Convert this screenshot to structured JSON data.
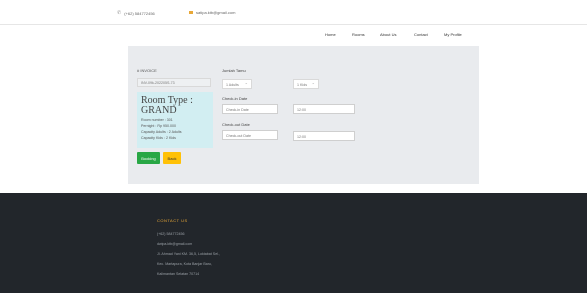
{
  "topbar": {
    "phone": "(+62) 584772456",
    "email": "satipa.ktb@gmail.com",
    "phone_icon": "phone-icon",
    "mail_icon": "mail-icon"
  },
  "nav": {
    "home": "Home",
    "rooms": "Rooms",
    "about": "About Us",
    "contact": "Contact",
    "profile": "My Profile"
  },
  "invoice": {
    "label": "# INVOICE",
    "code": "INV-09k-202205S-73"
  },
  "room": {
    "title": "Room Type : GRAND",
    "number": "Room number : 301",
    "per_night": "Pernight : Rp 950.000",
    "capacity_adults": "Capacity Adults : 2 Adults",
    "capacity_kids": "Capacity Kids : 2 Kids"
  },
  "buttons": {
    "booking": "Booking",
    "back": "Back"
  },
  "form": {
    "guests_label": "Jumlah Tamu",
    "adults_value": "1 Adults",
    "kids_value": "1 Kids",
    "checkin_label": "Check-in Date",
    "checkin_placeholder": "Check-in Date",
    "checkin_time": "12:00",
    "checkout_label": "Check-out Date",
    "checkout_placeholder": "Check-out Date",
    "checkout_time": "12:00"
  },
  "footer": {
    "heading": "CONTACT US",
    "phone": "(+62) 584772456",
    "email": "dwipa.ktb@gmail.com",
    "address1": "Jl. Ahmad Yani KM. 36,5, Loktabat Sel.,",
    "address2": "Kec. Martapura, Kota Banjar Baru,",
    "address3": "Kalimantan Selatan 70714"
  },
  "colors": {
    "accent": "#e8a838",
    "booking_button": "#28a745",
    "back_button": "#ffc107",
    "footer_bg": "#22262b",
    "room_box": "#d2eef2"
  }
}
